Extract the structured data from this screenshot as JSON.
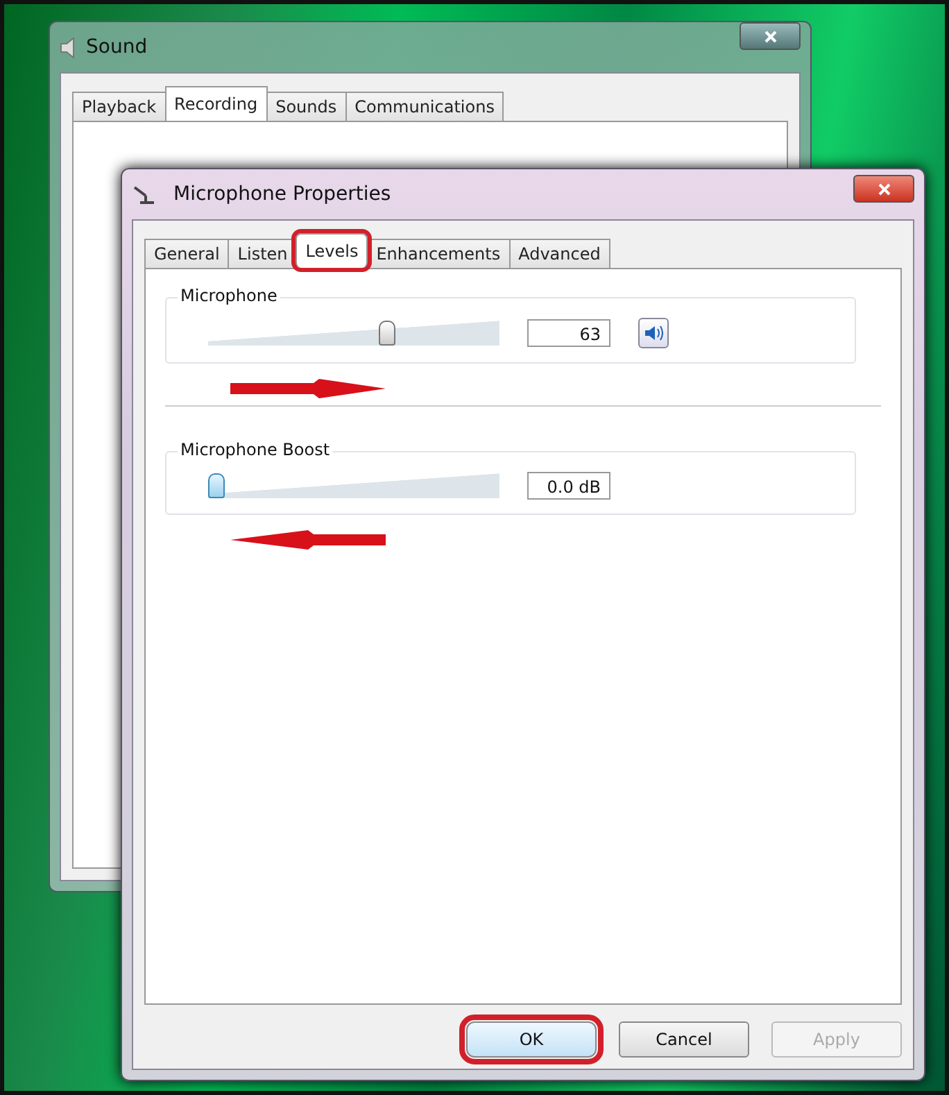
{
  "sound_window": {
    "title": "Sound",
    "tabs": [
      {
        "label": "Playback",
        "selected": false
      },
      {
        "label": "Recording",
        "selected": true
      },
      {
        "label": "Sounds",
        "selected": false
      },
      {
        "label": "Communications",
        "selected": false
      }
    ]
  },
  "properties_window": {
    "title": "Microphone Properties",
    "tabs": [
      {
        "label": "General",
        "selected": false,
        "highlighted": false
      },
      {
        "label": "Listen",
        "selected": false,
        "highlighted": false
      },
      {
        "label": "Levels",
        "selected": true,
        "highlighted": true
      },
      {
        "label": "Enhancements",
        "selected": false,
        "highlighted": false
      },
      {
        "label": "Advanced",
        "selected": false,
        "highlighted": false
      }
    ],
    "levels": [
      {
        "label": "Microphone",
        "level": 0.63,
        "reading": "63",
        "speaker_button": true,
        "arrow_points_left": false
      },
      {
        "label": "Microphone Boost",
        "level": 0,
        "reading": "0.0 dB",
        "speaker_button": false,
        "arrow_points_left": true
      }
    ],
    "buttons": [
      {
        "label": "OK",
        "disabled": false,
        "highlighted": true
      },
      {
        "label": "Cancel",
        "disabled": false,
        "highlighted": false
      },
      {
        "label": "Apply",
        "disabled": true,
        "highlighted": false
      }
    ]
  }
}
